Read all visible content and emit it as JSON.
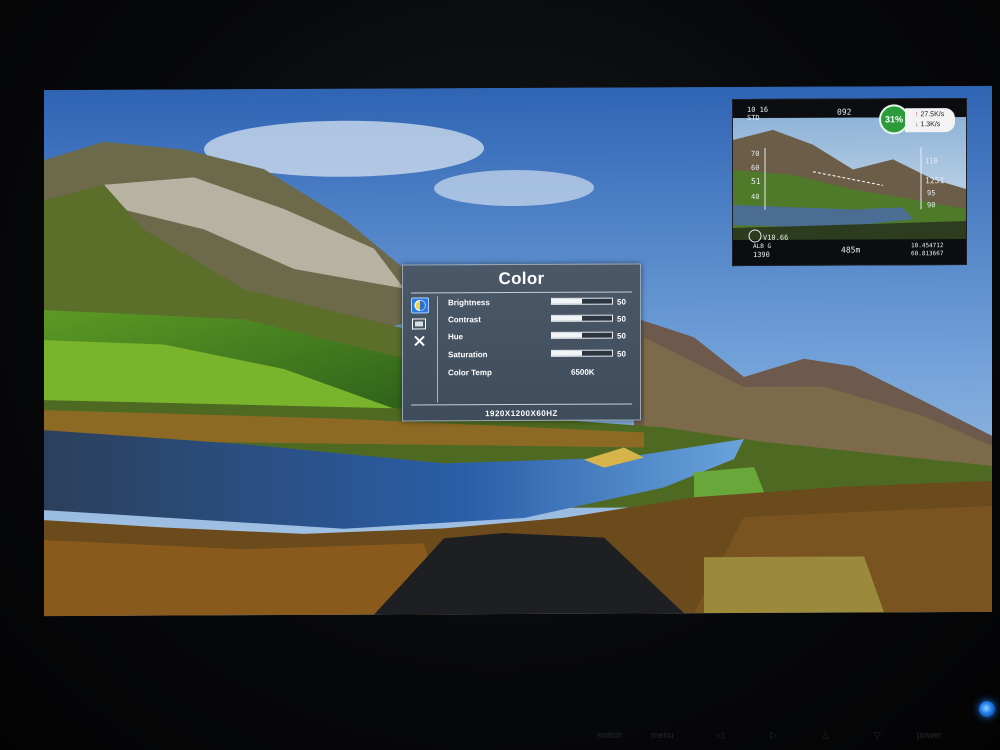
{
  "osd": {
    "title": "Color",
    "menu_icons": [
      "color-icon",
      "picture-icon",
      "tools-icon"
    ],
    "items": [
      {
        "label": "Brightness",
        "value": "50",
        "level": 0.5
      },
      {
        "label": "Contrast",
        "value": "50",
        "level": 0.5
      },
      {
        "label": "Hue",
        "value": "50",
        "level": 0.5
      },
      {
        "label": "Saturation",
        "value": "50",
        "level": 0.5
      },
      {
        "label": "Color Temp",
        "value": "6500K"
      }
    ],
    "resolution": "1920X1200X60HZ"
  },
  "pip": {
    "top_left_1": "10 16",
    "top_left_2": "STD",
    "heading": "092",
    "speed_percent": "31%",
    "upload": "27.5K/s",
    "download": "1.3K/s",
    "left_scale": [
      "70",
      "60",
      "51",
      "40"
    ],
    "right_scale": [
      "110",
      "1251",
      "95",
      "90"
    ],
    "bottom_left_1": "V10.66",
    "bottom_left_2": "ALB G",
    "bottom_left_3": "1390",
    "bottom_center": "485m",
    "bottom_right_1": "10.454712",
    "bottom_right_2": "60.813667"
  },
  "buttons": [
    "switch",
    "menu",
    "◁",
    "▷",
    "△",
    "▽",
    "power"
  ],
  "colors": {
    "osd_bg": "#4a5868",
    "osd_highlight": "#2c7be0",
    "speed_badge": "#2c9b3b",
    "power_led": "#1e7be8"
  }
}
